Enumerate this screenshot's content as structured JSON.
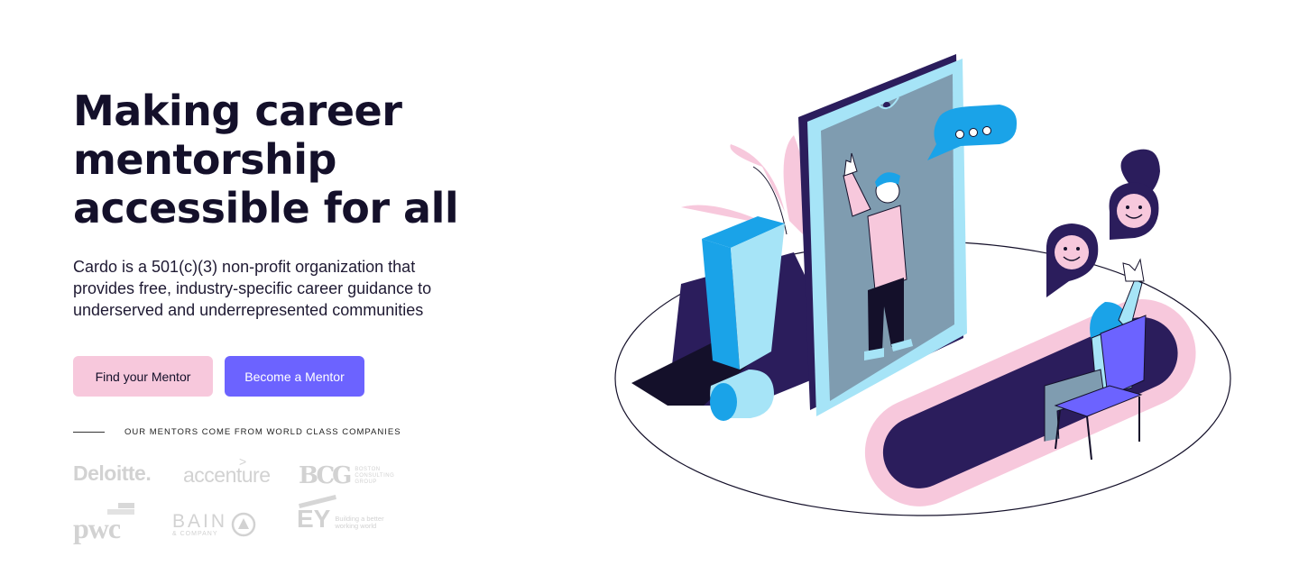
{
  "hero": {
    "headline_lines": [
      "Making career",
      "mentorship",
      "accessible for all"
    ],
    "description_lines": [
      "Cardo is a 501(c)(3) non-profit organization that",
      "provides free, industry-specific career guidance to",
      "underserved and underrepresented communities"
    ],
    "buttons": {
      "find_mentor": "Find your Mentor",
      "become_mentor": "Become a Mentor"
    },
    "companies_caption": "OUR MENTORS COME FROM WORLD CLASS COMPANIES"
  },
  "logos": {
    "deloitte": "Deloitte.",
    "accenture": "accenture",
    "accenture_caret": ">",
    "bcg": "BCG",
    "bcg_sub": [
      "BOSTON",
      "CONSULTING",
      "GROUP"
    ],
    "pwc": "pwc",
    "bain": "BAIN",
    "bain_sub": "& COMPANY",
    "ey": "EY",
    "ey_sub": [
      "Building a better",
      "working world"
    ]
  },
  "colors": {
    "primary": "#6c63ff",
    "pink": "#f7c8dc",
    "navy": "#2b1d5c",
    "cyan": "#1aa3e8",
    "light_cyan": "#a6e4f7",
    "text": "#14102a",
    "logo_gray": "#d2d2d2"
  },
  "icons": {
    "illustration": "video-call-mentorship-illustration",
    "chat_bubble": "chat-bubble-icon",
    "smiley": "smiley-pin-icon",
    "exclamation": "exclamation-icon"
  }
}
